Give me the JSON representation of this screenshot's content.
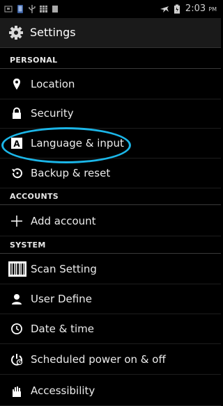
{
  "status_bar": {
    "time": "2:03",
    "ampm": "PM",
    "left_icons": [
      "notification-icon",
      "phone-icon",
      "usb-icon",
      "grid-icon",
      "square-icon"
    ],
    "right_icons": [
      "airplane-mode-icon",
      "battery-icon"
    ]
  },
  "action_bar": {
    "title": "Settings",
    "icon": "gear-icon"
  },
  "sections": {
    "personal": "PERSONAL",
    "accounts": "ACCOUNTS",
    "system": "SYSTEM"
  },
  "items": {
    "location": {
      "label": "Location",
      "icon": "location-pin-icon"
    },
    "security": {
      "label": "Security",
      "icon": "lock-icon"
    },
    "language": {
      "label": "Language & input",
      "icon": "keyboard-a-icon"
    },
    "backup": {
      "label": "Backup & reset",
      "icon": "backup-restore-icon"
    },
    "add_account": {
      "label": "Add account",
      "icon": "plus-icon"
    },
    "scan": {
      "label": "Scan Setting",
      "icon": "barcode-icon"
    },
    "user_define": {
      "label": "User Define",
      "icon": "user-icon"
    },
    "date_time": {
      "label": "Date & time",
      "icon": "clock-icon"
    },
    "scheduled": {
      "label": "Scheduled power on & off",
      "icon": "power-clock-icon"
    },
    "accessibility": {
      "label": "Accessibility",
      "icon": "hand-icon"
    }
  },
  "colors": {
    "highlight": "#1bb6e8",
    "background": "#000000"
  }
}
